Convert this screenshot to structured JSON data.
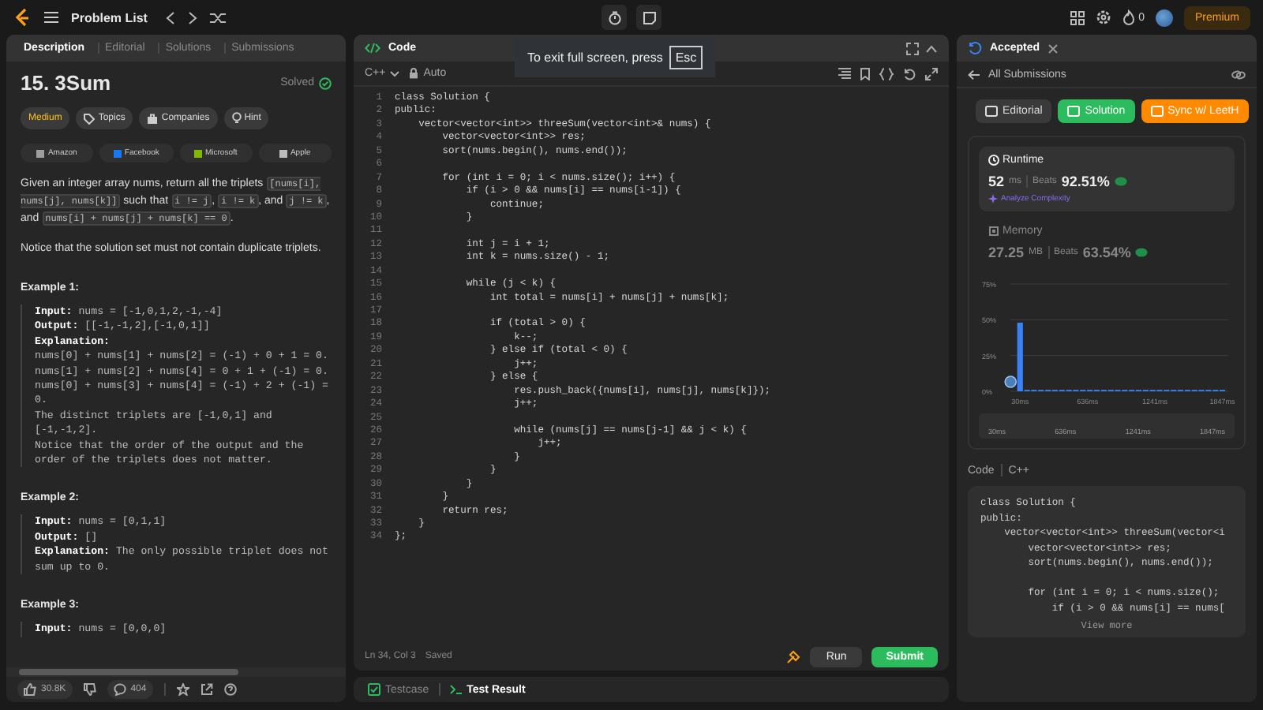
{
  "topbar": {
    "problem_list": "Problem List",
    "streak": "0",
    "premium": "Premium"
  },
  "left": {
    "tabs": [
      {
        "label": "Description",
        "selected": true
      },
      {
        "label": "Editorial",
        "selected": false
      },
      {
        "label": "Solutions",
        "selected": false
      },
      {
        "label": "Submissions",
        "selected": false
      }
    ],
    "title": "15. 3Sum",
    "status": "Solved",
    "tags": [
      {
        "label": "Medium",
        "kind": "difficulty"
      },
      {
        "label": "Topics",
        "kind": "topics"
      },
      {
        "label": "Companies",
        "kind": "companies"
      },
      {
        "label": "Hint",
        "kind": "hint"
      }
    ],
    "companies": [
      {
        "name": "Amazon",
        "color": "#9e9e9e"
      },
      {
        "name": "Facebook",
        "color": "#1877f2"
      },
      {
        "name": "Microsoft",
        "color": "#7fba00"
      },
      {
        "name": "Apple",
        "color": "#bdbdbd"
      }
    ],
    "paragraphs": [
      [
        {
          "t": "Given an integer array nums, return all the triplets ",
          "code": false
        },
        {
          "t": "[nums[i], nums[j], nums[k]]",
          "code": true
        },
        {
          "t": " such that ",
          "code": false
        },
        {
          "t": "i != j",
          "code": true
        },
        {
          "t": ", ",
          "code": false
        },
        {
          "t": "i != k",
          "code": true
        },
        {
          "t": ", and ",
          "code": false
        },
        {
          "t": "j != k",
          "code": true
        },
        {
          "t": ", and ",
          "code": false
        },
        {
          "t": "nums[i] + nums[j] + nums[k] == 0",
          "code": true
        },
        {
          "t": ".",
          "code": false
        }
      ],
      [
        {
          "t": "Notice that the solution set must not contain duplicate triplets.",
          "code": false
        }
      ]
    ],
    "examples": [
      {
        "title": "Example 1:",
        "lines": [
          "**Input:** nums = [-1,0,1,2,-1,-4]",
          "**Output:** [[-1,-1,2],[-1,0,1]]",
          "**Explanation:**",
          "nums[0] + nums[1] + nums[2] = (-1) + 0 + 1 = 0.",
          "nums[1] + nums[2] + nums[4] = 0 + 1 + (-1) = 0.",
          "nums[0] + nums[3] + nums[4] = (-1) + 2 + (-1) = 0.",
          "The distinct triplets are [-1,0,1] and [-1,-1,2].",
          "Notice that the order of the output and the order of the triplets does not matter."
        ]
      },
      {
        "title": "Example 2:",
        "lines": [
          "**Input:** nums = [0,1,1]",
          "**Output:** []",
          "**Explanation:** The only possible triplet does not sum up to 0."
        ]
      },
      {
        "title": "Example 3:",
        "lines": [
          "**Input:** nums = [0,0,0]"
        ]
      }
    ],
    "likes": "30.8K",
    "comments": "404"
  },
  "editor": {
    "title": "Code",
    "language": "C++",
    "mode": "Auto",
    "lines": [
      {
        "num": "1",
        "text": "class Solution {"
      },
      {
        "num": "2",
        "text": "public:"
      },
      {
        "num": "3",
        "text": "    vector<vector<int>> threeSum(vector<int>& nums) {"
      },
      {
        "num": "4",
        "text": "        vector<vector<int>> res;"
      },
      {
        "num": "5",
        "text": "        sort(nums.begin(), nums.end());"
      },
      {
        "num": "6"
      },
      {
        "num": "7",
        "text": "        for (int i = 0; i < nums.size(); i++) {"
      },
      {
        "num": "8",
        "text": "            if (i > 0 && nums[i] == nums[i-1]) {"
      },
      {
        "num": "9",
        "text": "                continue;"
      },
      {
        "num": "10",
        "text": "            }"
      },
      {
        "num": "11"
      },
      {
        "num": "12",
        "text": "            int j = i + 1;"
      },
      {
        "num": "13",
        "text": "            int k = nums.size() - 1;"
      },
      {
        "num": "14"
      },
      {
        "num": "15",
        "text": "            while (j < k) {"
      },
      {
        "num": "16",
        "text": "                int total = nums[i] + nums[j] + nums[k];"
      },
      {
        "num": "17"
      },
      {
        "num": "18",
        "text": "                if (total > 0) {"
      },
      {
        "num": "19",
        "text": "                    k--;"
      },
      {
        "num": "20",
        "text": "                } else if (total < 0) {"
      },
      {
        "num": "21",
        "text": "                    j++;"
      },
      {
        "num": "22",
        "text": "                } else {"
      },
      {
        "num": "23",
        "text": "                    res.push_back({nums[i], nums[j], nums[k]});"
      },
      {
        "num": "24",
        "text": "                    j++;"
      },
      {
        "num": "25"
      },
      {
        "num": "26",
        "text": "                    while (nums[j] == nums[j-1] && j < k) {"
      },
      {
        "num": "27",
        "text": "                        j++;"
      },
      {
        "num": "28",
        "text": "                    }"
      },
      {
        "num": "29",
        "text": "                }"
      },
      {
        "num": "30",
        "text": "            }"
      },
      {
        "num": "31",
        "text": "        }"
      },
      {
        "num": "32",
        "text": "        return res;"
      },
      {
        "num": "33",
        "text": "    }"
      },
      {
        "num": "34",
        "text": "};"
      }
    ],
    "cursor": "Ln 34, Col 3",
    "save_state": "Saved",
    "run": "Run",
    "submit": "Submit"
  },
  "bottom_tabs": [
    {
      "label": "Testcase",
      "selected": false
    },
    {
      "label": "Test Result",
      "selected": true
    }
  ],
  "fullscreen_toast": {
    "text": "To exit full screen, press",
    "key": "Esc"
  },
  "result": {
    "tab": "Accepted",
    "back": "All Submissions",
    "buttons": [
      {
        "label": "Editorial",
        "kind": "plain"
      },
      {
        "label": "Solution",
        "kind": "green"
      },
      {
        "label": "Sync w/ LeetH",
        "kind": "orange"
      }
    ],
    "metrics": [
      {
        "kind": "runtime",
        "label": "Runtime",
        "value": "52",
        "unit": "ms",
        "beats_label": "Beats",
        "beats": "92.51%",
        "selected": true,
        "link": "Analyze Complexity"
      },
      {
        "kind": "memory",
        "label": "Memory",
        "value": "27.25",
        "unit": "MB",
        "beats_label": "Beats",
        "beats": "63.54%",
        "selected": false
      }
    ],
    "chart_data": {
      "type": "bar",
      "x": [
        30,
        93,
        155,
        218,
        281,
        343,
        406,
        469,
        531,
        594,
        657,
        719,
        782,
        845,
        907,
        970,
        1033,
        1095,
        1158,
        1221,
        1283,
        1346,
        1409,
        1471,
        1534,
        1597,
        1659,
        1722,
        1785,
        1847
      ],
      "values": [
        48,
        1,
        1,
        1,
        1,
        1,
        1,
        1,
        1,
        1,
        1,
        1,
        1,
        1,
        1,
        1,
        1,
        1,
        1,
        1,
        1,
        1,
        1,
        1,
        1,
        1,
        1,
        1,
        1,
        1
      ],
      "xlim": [
        0,
        1900
      ],
      "ylim": [
        0,
        75
      ],
      "xticks": [
        {
          "value": 30,
          "label": "30ms"
        },
        {
          "value": 636,
          "label": "636ms"
        },
        {
          "value": 1241,
          "label": "1241ms"
        },
        {
          "value": 1847,
          "label": "1847ms"
        }
      ],
      "yticks": [
        {
          "value": 0,
          "label": "0%"
        },
        {
          "value": 25,
          "label": "25%"
        },
        {
          "value": 50,
          "label": "50%"
        },
        {
          "value": 75,
          "label": "75%"
        }
      ]
    },
    "range_labels": [
      "30ms",
      "636ms",
      "1241ms",
      "1847ms"
    ],
    "code_label": "Code",
    "code_language": "C++",
    "code_blocks": [
      [
        "class Solution {",
        "public:",
        "    vector<vector<int>> threeSum(vector<i",
        "        vector<vector<int>> res;",
        "        sort(nums.begin(), nums.end());"
      ],
      [
        "        for (int i = 0; i < nums.size();",
        "            if (i > 0 && nums[i] == nums["
      ]
    ],
    "view_more": "View more"
  }
}
